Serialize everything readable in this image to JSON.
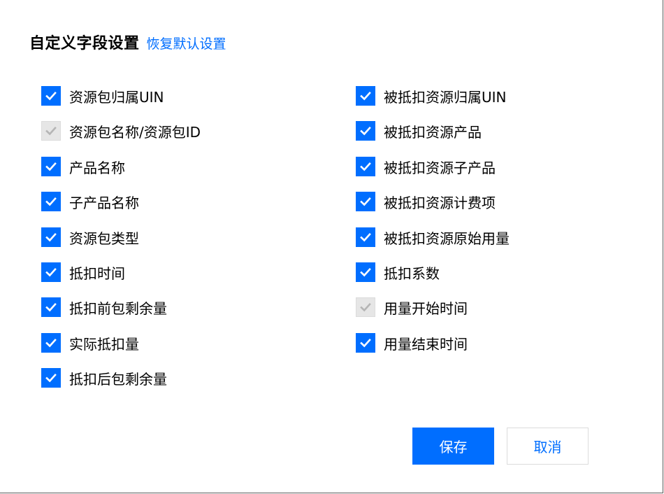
{
  "dialog": {
    "title": "自定义字段设置",
    "reset_link": "恢复默认设置"
  },
  "left_options": [
    {
      "label": "资源包归属UIN",
      "checked": true,
      "disabled": false
    },
    {
      "label": "资源包名称/资源包ID",
      "checked": true,
      "disabled": true
    },
    {
      "label": "产品名称",
      "checked": true,
      "disabled": false
    },
    {
      "label": "子产品名称",
      "checked": true,
      "disabled": false
    },
    {
      "label": "资源包类型",
      "checked": true,
      "disabled": false
    },
    {
      "label": "抵扣时间",
      "checked": true,
      "disabled": false
    },
    {
      "label": "抵扣前包剩余量",
      "checked": true,
      "disabled": false
    },
    {
      "label": "实际抵扣量",
      "checked": true,
      "disabled": false
    },
    {
      "label": "抵扣后包剩余量",
      "checked": true,
      "disabled": false
    }
  ],
  "right_options": [
    {
      "label": "被抵扣资源归属UIN",
      "checked": true,
      "disabled": false
    },
    {
      "label": "被抵扣资源产品",
      "checked": true,
      "disabled": false
    },
    {
      "label": "被抵扣资源子产品",
      "checked": true,
      "disabled": false
    },
    {
      "label": "被抵扣资源计费项",
      "checked": true,
      "disabled": false
    },
    {
      "label": "被抵扣资源原始用量",
      "checked": true,
      "disabled": false
    },
    {
      "label": "抵扣系数",
      "checked": true,
      "disabled": false
    },
    {
      "label": "用量开始时间",
      "checked": true,
      "disabled": true
    },
    {
      "label": "用量结束时间",
      "checked": true,
      "disabled": false
    }
  ],
  "buttons": {
    "save": "保存",
    "cancel": "取消"
  },
  "colors": {
    "accent": "#006eff",
    "disabled_box": "#e6e6e6",
    "disabled_check": "#b5b5b5"
  },
  "icons": {
    "checked": "check-icon"
  }
}
